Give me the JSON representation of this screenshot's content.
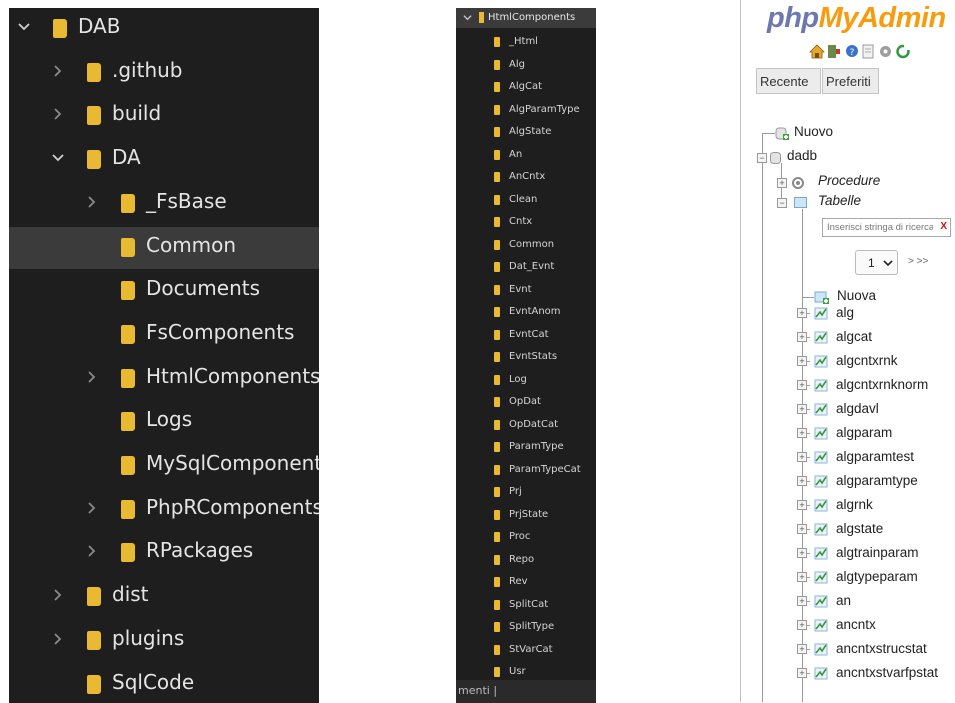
{
  "explorer_large": {
    "items": [
      {
        "label": "DAB",
        "expanded": true,
        "selected": false
      },
      {
        "label": ".github",
        "expanded": false,
        "selected": false
      },
      {
        "label": "build",
        "expanded": false,
        "selected": false
      },
      {
        "label": "DA",
        "expanded": true,
        "selected": false
      },
      {
        "label": "_FsBase",
        "expanded": false,
        "selected": false
      },
      {
        "label": "Common",
        "expanded": null,
        "selected": true
      },
      {
        "label": "Documents",
        "expanded": null,
        "selected": false
      },
      {
        "label": "FsComponents",
        "expanded": null,
        "selected": false
      },
      {
        "label": "HtmlComponents",
        "expanded": false,
        "selected": false
      },
      {
        "label": "Logs",
        "expanded": null,
        "selected": false
      },
      {
        "label": "MySqlComponents",
        "expanded": null,
        "selected": false
      },
      {
        "label": "PhpRComponents",
        "expanded": false,
        "selected": false
      },
      {
        "label": "RPackages",
        "expanded": false,
        "selected": false
      },
      {
        "label": "dist",
        "expanded": false,
        "selected": false
      },
      {
        "label": "plugins",
        "expanded": false,
        "selected": false
      },
      {
        "label": "SqlCode",
        "expanded": null,
        "selected": false
      }
    ]
  },
  "explorer_small": {
    "header": "HtmlComponents",
    "items": [
      "_Html",
      "Alg",
      "AlgCat",
      "AlgParamType",
      "AlgState",
      "An",
      "AnCntx",
      "Clean",
      "Cntx",
      "Common",
      "Dat_Evnt",
      "Evnt",
      "EvntAnom",
      "EvntCat",
      "EvntStats",
      "Log",
      "OpDat",
      "OpDatCat",
      "ParamType",
      "ParamTypeCat",
      "Prj",
      "PrjState",
      "Proc",
      "Repo",
      "Rev",
      "SplitCat",
      "SplitType",
      "StVarCat",
      "Usr"
    ],
    "status": "menti |"
  },
  "phpmyadmin": {
    "logo_part1": "php",
    "logo_part2": "MyAdmin",
    "recent_button": "Recente",
    "favorites_button": "Preferiti",
    "new_db": "Nuovo",
    "database": "dadb",
    "procedures": "Procedure",
    "tables": "Tabelle",
    "filter_placeholder": "Inserisci stringa di ricerca",
    "filter_clear": "X",
    "page_select": "1",
    "page_next": "> >>",
    "new_table": "Nuova",
    "table_list": [
      "alg",
      "algcat",
      "algcntxrnk",
      "algcntxrnknorm",
      "algdavl",
      "algparam",
      "algparamtest",
      "algparamtype",
      "algrnk",
      "algstate",
      "algtrainparam",
      "algtypeparam",
      "an",
      "ancntx",
      "ancntxstrucstat",
      "ancntxstvarfpstat"
    ]
  },
  "colors": {
    "folder": "#e8b931",
    "dark_bg": "#1e1e1e",
    "selected_row": "#3b3b3b",
    "pma_blue": "#6c78af",
    "pma_orange": "#f89c0e"
  }
}
